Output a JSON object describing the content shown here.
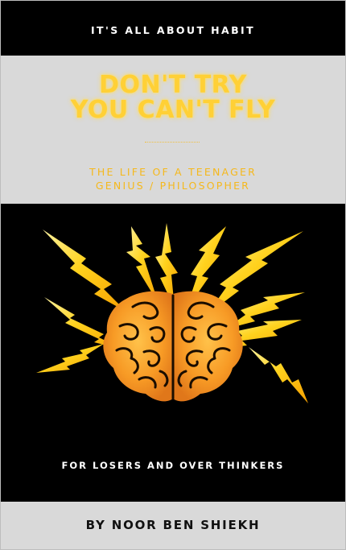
{
  "cover": {
    "series": "IT'S ALL ABOUT HABIT",
    "title_lines": [
      "DON'T TRY",
      "YOU CAN'T FLY"
    ],
    "subtitle_lines": [
      "THE LIFE OF A TEENAGER",
      "GENIUS / PHILOSOPHER"
    ],
    "tagline": "FOR LOSERS AND OVER THINKERS",
    "author": "BY NOOR BEN SHIEKH",
    "illustration": "glowing-brain-with-lightning-bolts"
  },
  "colors": {
    "background_dark": "#000000",
    "band_light": "#d9d9d9",
    "title_yellow": "#ffd036",
    "subtitle_gold": "#f5b81c",
    "bolt_yellow": "#ffd21e",
    "brain_orange": "#f39c26",
    "text_white": "#ffffff",
    "author_text": "#111111"
  }
}
